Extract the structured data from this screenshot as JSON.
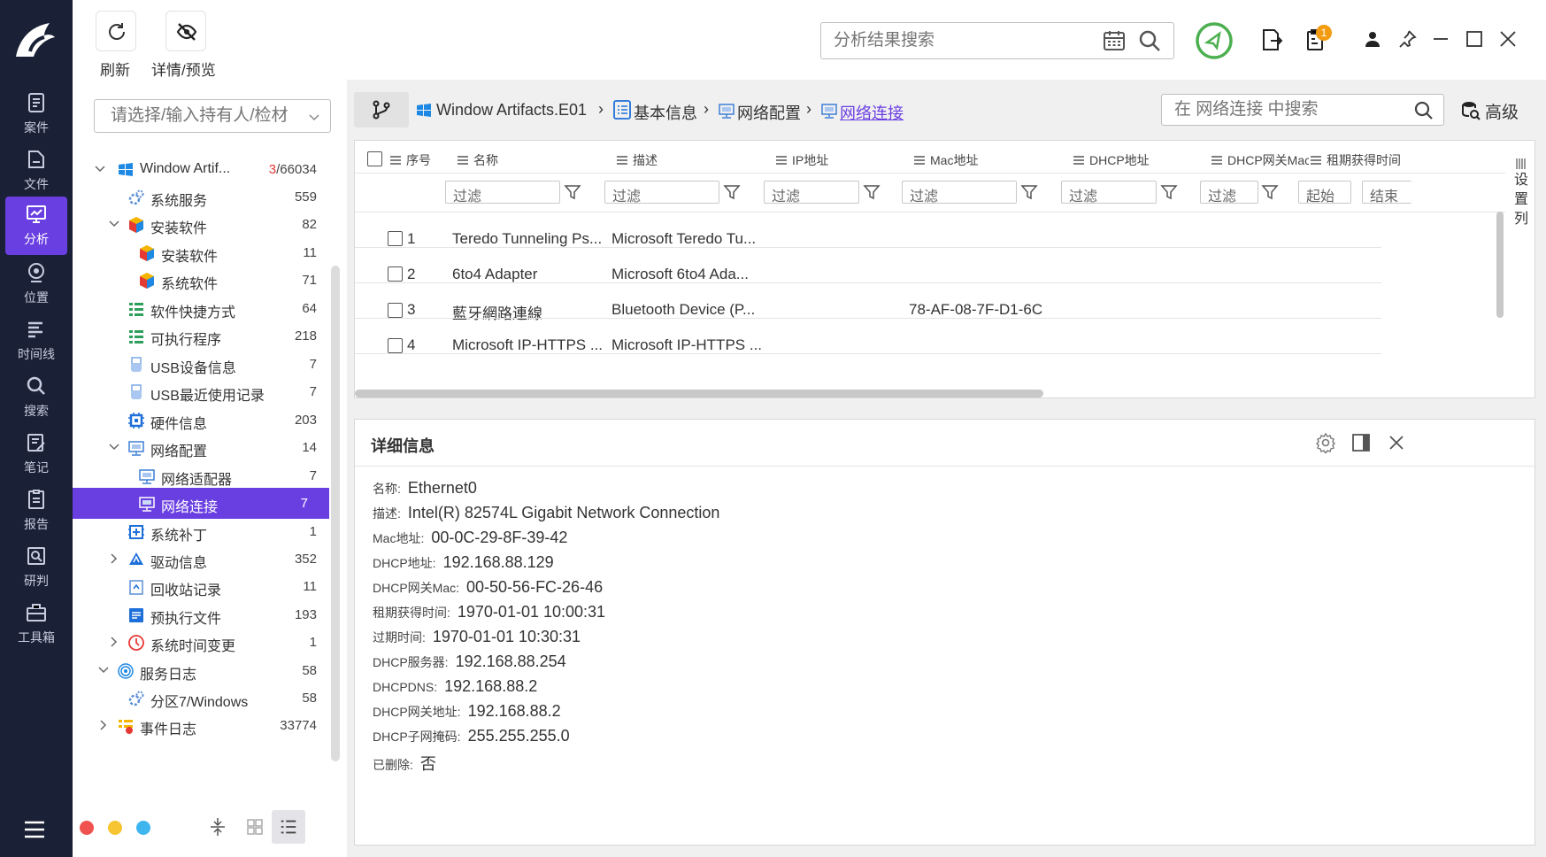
{
  "toolbar": {
    "refresh_label": "刷新",
    "detail_label": "详情/预览",
    "search_placeholder": "分析结果搜索",
    "badge_count": "1"
  },
  "nav": {
    "items": [
      {
        "label": "案件",
        "icon": "case-icon"
      },
      {
        "label": "文件",
        "icon": "file-icon"
      },
      {
        "label": "分析",
        "icon": "analysis-icon",
        "active": true
      },
      {
        "label": "位置",
        "icon": "location-icon"
      },
      {
        "label": "时间线",
        "icon": "timeline-icon"
      },
      {
        "label": "搜索",
        "icon": "search-icon"
      },
      {
        "label": "笔记",
        "icon": "notes-icon"
      },
      {
        "label": "报告",
        "icon": "report-icon"
      },
      {
        "label": "研判",
        "icon": "judge-icon"
      },
      {
        "label": "工具箱",
        "icon": "toolbox-icon"
      }
    ]
  },
  "left": {
    "owner_placeholder": "请选择/输入持有人/检材",
    "tree": [
      {
        "label": "Window Artif...",
        "count_red": "3",
        "count": "/66034"
      },
      {
        "label": "系统服务",
        "count": "559"
      },
      {
        "label": "安装软件",
        "count": "82"
      },
      {
        "label": "安装软件",
        "count": "11"
      },
      {
        "label": "系统软件",
        "count": "71"
      },
      {
        "label": "软件快捷方式",
        "count": "64"
      },
      {
        "label": "可执行程序",
        "count": "218"
      },
      {
        "label": "USB设备信息",
        "count": "7"
      },
      {
        "label": "USB最近使用记录",
        "count": "7"
      },
      {
        "label": "硬件信息",
        "count": "203"
      },
      {
        "label": "网络配置",
        "count": "14"
      },
      {
        "label": "网络适配器",
        "count": "7"
      },
      {
        "label": "网络连接",
        "count": "7"
      },
      {
        "label": "系统补丁",
        "count": "1"
      },
      {
        "label": "驱动信息",
        "count": "352"
      },
      {
        "label": "回收站记录",
        "count": "11"
      },
      {
        "label": "预执行文件",
        "count": "193"
      },
      {
        "label": "系统时间变更",
        "count": "1"
      },
      {
        "label": "服务日志",
        "count": "58"
      },
      {
        "label": "分区7/Windows",
        "count": "58"
      },
      {
        "label": "事件日志",
        "count": "33774"
      }
    ]
  },
  "breadcrumb": {
    "items": [
      "Window Artifacts.E01",
      "基本信息",
      "网络配置",
      "网络连接"
    ],
    "grid_search_placeholder": "在 网络连接 中搜索",
    "advanced_label": "高级"
  },
  "grid": {
    "columns": [
      "序号",
      "名称",
      "描述",
      "IP地址",
      "Mac地址",
      "DHCP地址",
      "DHCP网关Mac",
      "租期获得时间"
    ],
    "filter_label": "过滤",
    "start_label": "起始",
    "end_label": "结束",
    "col_settings_label": "设置列",
    "rows": [
      {
        "no": "1",
        "name": "Teredo Tunneling Ps...",
        "desc": "Microsoft Teredo Tu...",
        "mac": ""
      },
      {
        "no": "2",
        "name": "6to4 Adapter",
        "desc": "Microsoft 6to4 Ada...",
        "mac": ""
      },
      {
        "no": "3",
        "name": "藍牙網路連線",
        "desc": "Bluetooth Device (P...",
        "mac": "78-AF-08-7F-D1-6C"
      },
      {
        "no": "4",
        "name": "Microsoft IP-HTTPS ...",
        "desc": "Microsoft IP-HTTPS ...",
        "mac": ""
      }
    ]
  },
  "detail": {
    "title": "详细信息",
    "fields": [
      {
        "k": "名称:",
        "v": "Ethernet0"
      },
      {
        "k": "描述:",
        "v": "Intel(R) 82574L Gigabit Network Connection"
      },
      {
        "k": "Mac地址:",
        "v": "00-0C-29-8F-39-42"
      },
      {
        "k": "DHCP地址:",
        "v": "192.168.88.129"
      },
      {
        "k": "DHCP网关Mac:",
        "v": "00-50-56-FC-26-46"
      },
      {
        "k": "租期获得时间:",
        "v": "1970-01-01 10:00:31"
      },
      {
        "k": "过期时间:",
        "v": "1970-01-01 10:30:31"
      },
      {
        "k": "DHCP服务器:",
        "v": "192.168.88.254"
      },
      {
        "k": "DHCPDNS:",
        "v": "192.168.88.2"
      },
      {
        "k": "DHCP网关地址:",
        "v": "192.168.88.2"
      },
      {
        "k": "DHCP子网掩码:",
        "v": "255.255.255.0"
      },
      {
        "k": "已删除:",
        "v": "否"
      }
    ]
  },
  "colors": {
    "accent": "#6a3fe2",
    "nav_bg": "#1a2035",
    "shield": "#4caf50",
    "badge": "#f39c12"
  }
}
